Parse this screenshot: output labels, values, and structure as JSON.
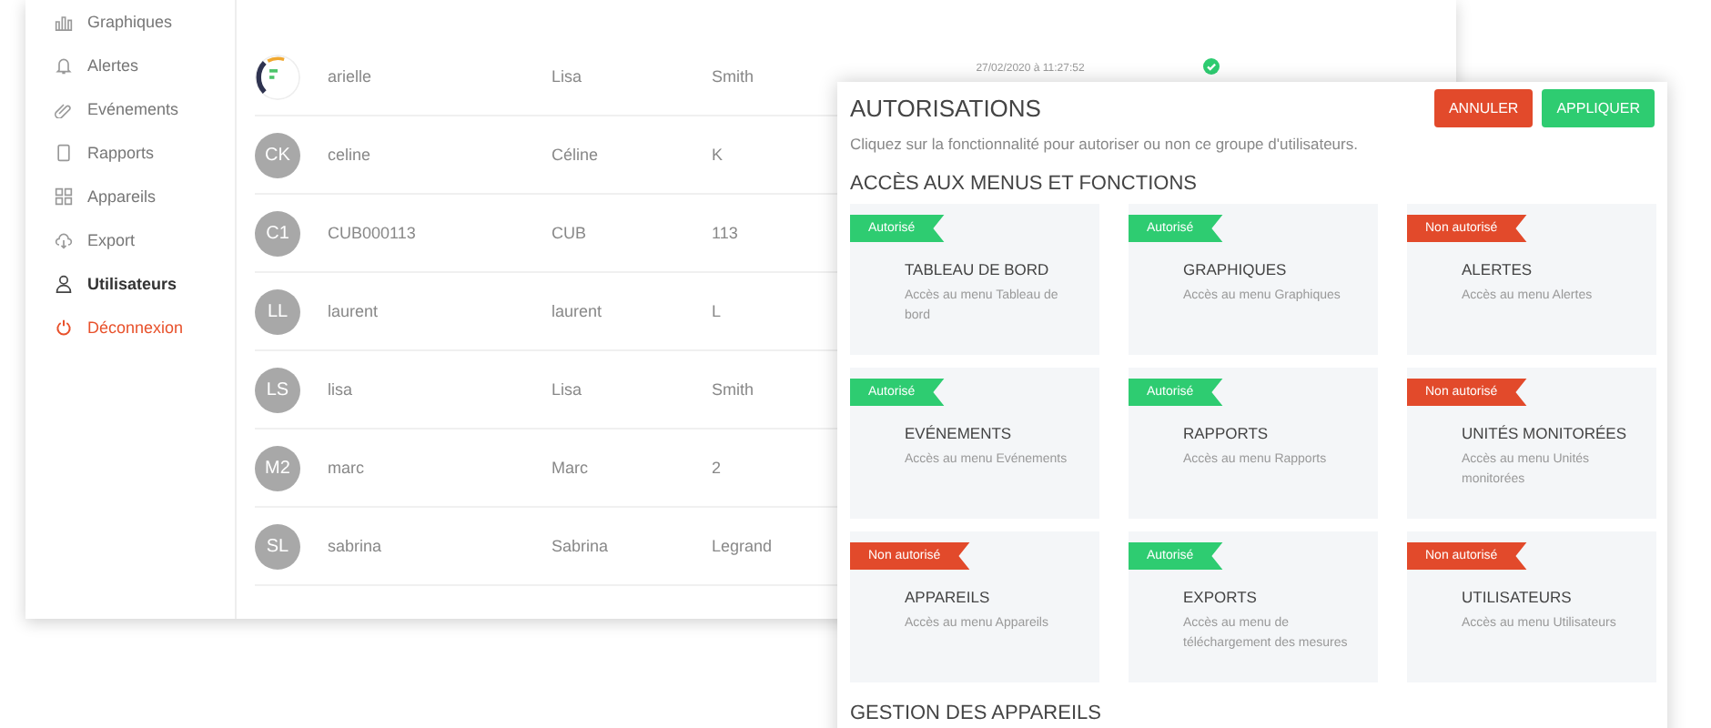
{
  "sidebar": {
    "items": [
      {
        "label": "Graphiques",
        "kind": "link",
        "selected": false
      },
      {
        "label": "Alertes",
        "kind": "link",
        "selected": false
      },
      {
        "label": "Evénements",
        "kind": "link",
        "selected": false
      },
      {
        "label": "Rapports",
        "kind": "link",
        "selected": false
      },
      {
        "label": "Appareils",
        "kind": "link",
        "selected": false
      },
      {
        "label": "Export",
        "kind": "link",
        "selected": false
      },
      {
        "label": "Utilisateurs",
        "kind": "link",
        "selected": true
      },
      {
        "label": "Déconnexion",
        "kind": "logout",
        "selected": false
      }
    ]
  },
  "users": {
    "rows": [
      {
        "avatar": {
          "kind": "photo"
        },
        "username": "arielle",
        "first_name": "Lisa",
        "last_name": "Smith",
        "last_login": "27/02/2020 à 11:27:52",
        "active": true
      },
      {
        "avatar": {
          "kind": "initials",
          "text": "CK"
        },
        "username": "celine",
        "first_name": "Céline",
        "last_name": "K"
      },
      {
        "avatar": {
          "kind": "initials",
          "text": "C1"
        },
        "username": "CUB000113",
        "first_name": "CUB",
        "last_name": "113"
      },
      {
        "avatar": {
          "kind": "initials",
          "text": "LL"
        },
        "username": "laurent",
        "first_name": "laurent",
        "last_name": "L"
      },
      {
        "avatar": {
          "kind": "initials",
          "text": "LS"
        },
        "username": "lisa",
        "first_name": "Lisa",
        "last_name": "Smith"
      },
      {
        "avatar": {
          "kind": "initials",
          "text": "M2"
        },
        "username": "marc",
        "first_name": "Marc",
        "last_name": "2"
      },
      {
        "avatar": {
          "kind": "initials",
          "text": "SL"
        },
        "username": "sabrina",
        "first_name": "Sabrina",
        "last_name": "Legrand"
      }
    ]
  },
  "dialog": {
    "title": "AUTORISATIONS",
    "hint": "Cliquez sur la fonctionnalité pour autoriser ou non ce groupe d'utilisateurs.",
    "buttons": [
      {
        "label": "ANNULER",
        "kind": "cancel"
      },
      {
        "label": "APPLIQUER",
        "kind": "apply"
      }
    ],
    "sections": [
      {
        "title": "ACCÈS AUX MENUS ET FONCTIONS",
        "features": [
          {
            "badge": "Autorisé",
            "allowed": true,
            "name": "TABLEAU DE BORD",
            "description": "Accès au menu Tableau de bord"
          },
          {
            "badge": "Autorisé",
            "allowed": true,
            "name": "GRAPHIQUES",
            "description": "Accès au menu Graphiques"
          },
          {
            "badge": "Non autorisé",
            "allowed": false,
            "name": "ALERTES",
            "description": "Accès au menu Alertes"
          },
          {
            "badge": "Autorisé",
            "allowed": true,
            "name": "EVÉNEMENTS",
            "description": "Accès au menu Evénements"
          },
          {
            "badge": "Autorisé",
            "allowed": true,
            "name": "RAPPORTS",
            "description": "Accès au menu Rapports"
          },
          {
            "badge": "Non autorisé",
            "allowed": false,
            "name": "UNITÉS MONITORÉES",
            "description": "Accès au menu Unités monitorées"
          },
          {
            "badge": "Non autorisé",
            "allowed": false,
            "name": "APPAREILS",
            "description": "Accès au menu Appareils"
          },
          {
            "badge": "Autorisé",
            "allowed": true,
            "name": "EXPORTS",
            "description": "Accès au menu de téléchargement des mesures"
          },
          {
            "badge": "Non autorisé",
            "allowed": false,
            "name": "UTILISATEURS",
            "description": "Accès au menu Utilisateurs"
          }
        ]
      },
      {
        "title": "GESTION DES APPAREILS"
      }
    ]
  }
}
